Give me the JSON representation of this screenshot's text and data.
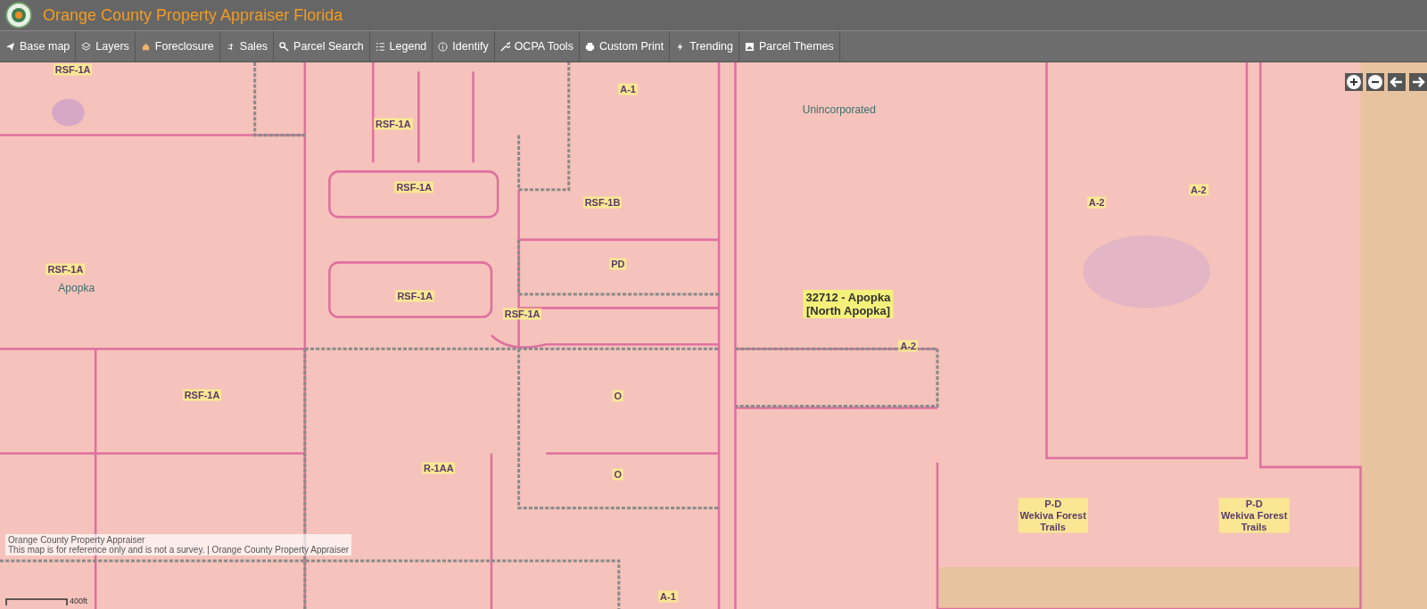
{
  "header": {
    "title": "Orange County Property Appraiser Florida"
  },
  "toolbar": [
    {
      "label": "Base map"
    },
    {
      "label": "Layers"
    },
    {
      "label": "Foreclosure"
    },
    {
      "label": "Sales"
    },
    {
      "label": "Parcel Search"
    },
    {
      "label": "Legend"
    },
    {
      "label": "Identify"
    },
    {
      "label": "OCPA Tools"
    },
    {
      "label": "Custom Print"
    },
    {
      "label": "Trending"
    },
    {
      "label": "Parcel Themes"
    }
  ],
  "map": {
    "labels": [
      {
        "kind": "zoning",
        "text": "RSF-1A"
      },
      {
        "kind": "zoning",
        "text": "RSF-1A"
      },
      {
        "kind": "zoning",
        "text": "RSF-1A"
      },
      {
        "kind": "zoning",
        "text": "RSF-1B"
      },
      {
        "kind": "zoning",
        "text": "PD"
      },
      {
        "kind": "zoning",
        "text": "RSF-1A"
      },
      {
        "kind": "zoning",
        "text": "RSF-1A"
      },
      {
        "kind": "zoning",
        "text": "RSF-1A"
      },
      {
        "kind": "zoning",
        "text": "RSF-1A"
      },
      {
        "kind": "zoning",
        "text": "O"
      },
      {
        "kind": "zoning",
        "text": "R-1AA"
      },
      {
        "kind": "zoning",
        "text": "O"
      },
      {
        "kind": "zoning",
        "text": "A-1"
      },
      {
        "kind": "zoning",
        "text": "A-1"
      },
      {
        "kind": "zoning",
        "text": "A-2"
      },
      {
        "kind": "zoning",
        "text": "A-2"
      },
      {
        "kind": "zoning",
        "text": "A-2"
      },
      {
        "kind": "zoning",
        "text": "P-D\nWekiva Forest\nTrails"
      },
      {
        "kind": "zoning",
        "text": "P-D\nWekiva Forest\nTrails"
      },
      {
        "kind": "place",
        "text": "Unincorporated"
      },
      {
        "kind": "place",
        "text": "Apopka"
      },
      {
        "kind": "address",
        "text": "32712 - Apopka\n[North Apopka]"
      }
    ],
    "attribution": [
      "Orange County Property Appraiser",
      "This map is for reference only and is not a survey. | Orange County Property Appraiser"
    ],
    "scale": "400ft"
  }
}
